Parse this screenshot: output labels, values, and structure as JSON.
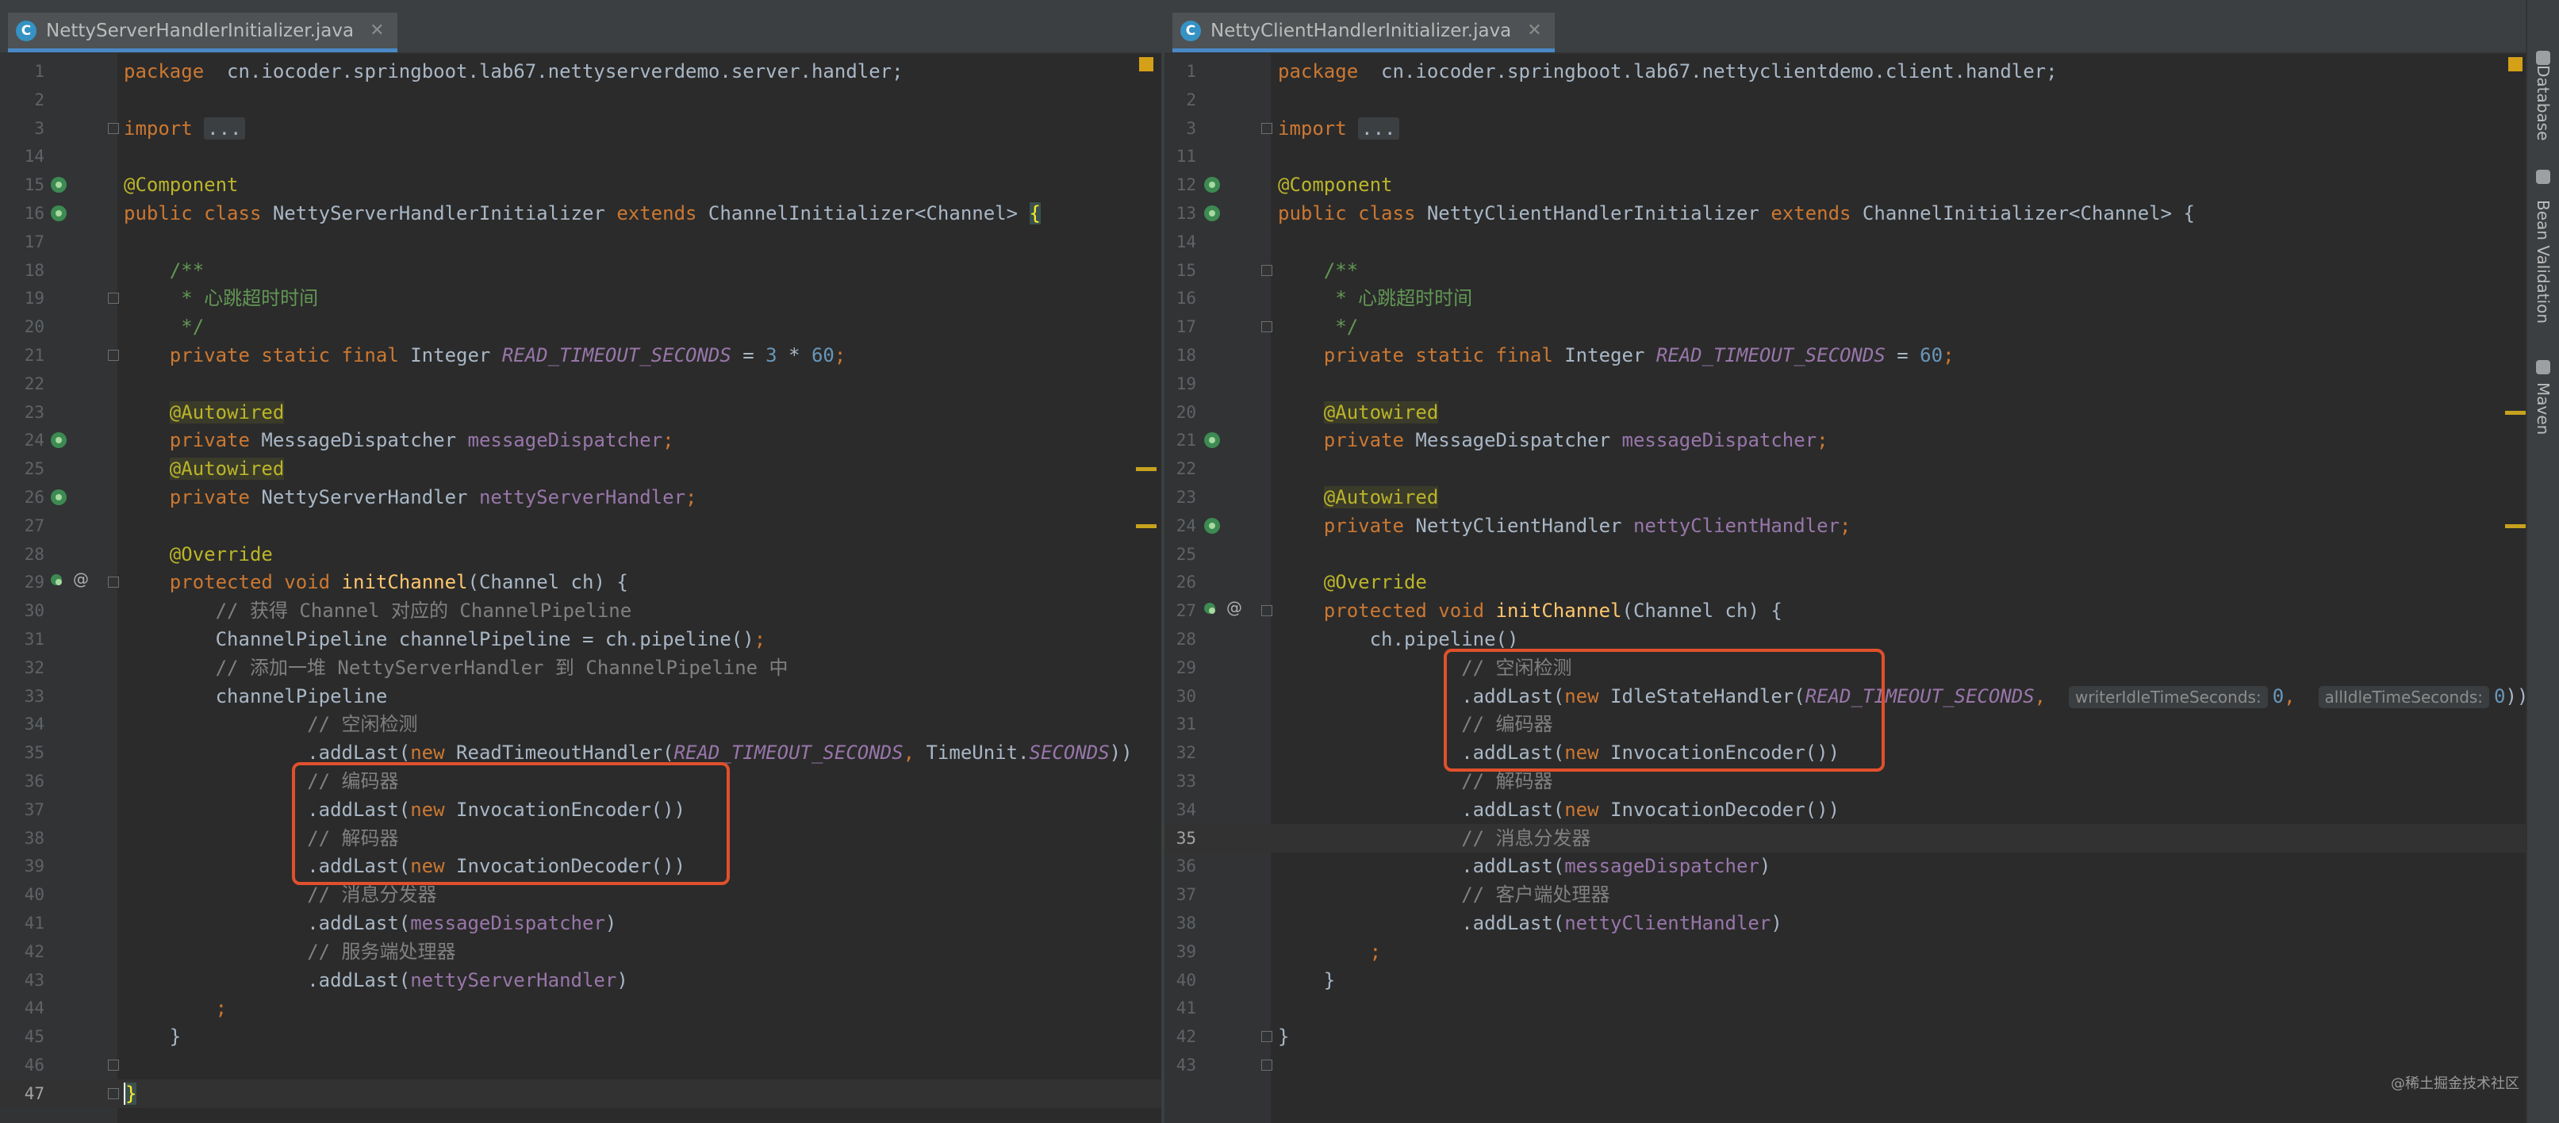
{
  "left_editor": {
    "tab_label": "NettyServerHandlerInitializer.java",
    "tab_icon": "C",
    "lines": [
      {
        "n": "1",
        "parts": [
          [
            "kw",
            "package"
          ],
          [
            "",
            "  cn.iocoder.springboot.lab67.nettyserverdemo.server.handler;"
          ]
        ]
      },
      {
        "n": "2",
        "parts": []
      },
      {
        "n": "3",
        "parts": [
          [
            "kw",
            "import"
          ],
          [
            "",
            " "
          ],
          [
            "fold-ph",
            "..."
          ]
        ]
      },
      {
        "n": "14",
        "parts": []
      },
      {
        "n": "15",
        "parts": [
          [
            "an",
            "@Component"
          ]
        ]
      },
      {
        "n": "16",
        "parts": [
          [
            "kw",
            "public class"
          ],
          [
            "",
            " NettyServerHandlerInitializer "
          ],
          [
            "kw",
            "extends"
          ],
          [
            "",
            " ChannelInitializer<Channel> "
          ],
          [
            "brace-match",
            "{"
          ]
        ]
      },
      {
        "n": "17",
        "parts": []
      },
      {
        "n": "18",
        "parts": [
          [
            "doc",
            "    /**"
          ]
        ]
      },
      {
        "n": "19",
        "parts": [
          [
            "doc",
            "     * 心跳超时时间"
          ]
        ]
      },
      {
        "n": "20",
        "parts": [
          [
            "doc",
            "     */"
          ]
        ]
      },
      {
        "n": "21",
        "parts": [
          [
            "kw",
            "    private static final"
          ],
          [
            "",
            " Integer "
          ],
          [
            "sfld",
            "READ_TIMEOUT_SECONDS"
          ],
          [
            "",
            " = "
          ],
          [
            "num",
            "3"
          ],
          [
            "",
            " * "
          ],
          [
            "num",
            "60"
          ],
          [
            "kw",
            ";"
          ]
        ]
      },
      {
        "n": "22",
        "parts": []
      },
      {
        "n": "23",
        "parts": [
          [
            "",
            "    "
          ],
          [
            "an-hl",
            "@Autowired"
          ]
        ]
      },
      {
        "n": "24",
        "parts": [
          [
            "kw",
            "    private"
          ],
          [
            "",
            " MessageDispatcher "
          ],
          [
            "fld",
            "messageDispatcher"
          ],
          [
            "kw",
            ";"
          ]
        ]
      },
      {
        "n": "25",
        "parts": [
          [
            "",
            "    "
          ],
          [
            "an-hl",
            "@Autowired"
          ]
        ]
      },
      {
        "n": "26",
        "parts": [
          [
            "kw",
            "    private"
          ],
          [
            "",
            " NettyServerHandler "
          ],
          [
            "fld",
            "nettyServerHandler"
          ],
          [
            "kw",
            ";"
          ]
        ]
      },
      {
        "n": "27",
        "parts": []
      },
      {
        "n": "28",
        "parts": [
          [
            "an",
            "    @Override"
          ]
        ]
      },
      {
        "n": "29",
        "parts": [
          [
            "kw",
            "    protected void"
          ],
          [
            "",
            " "
          ],
          [
            "fn",
            "initChannel"
          ],
          [
            "",
            "(Channel ch) {"
          ]
        ]
      },
      {
        "n": "30",
        "parts": [
          [
            "cm",
            "        // 获得 Channel 对应的 ChannelPipeline"
          ]
        ]
      },
      {
        "n": "31",
        "parts": [
          [
            "",
            "        ChannelPipeline channelPipeline = ch.pipeline()"
          ],
          [
            "kw",
            ";"
          ]
        ]
      },
      {
        "n": "32",
        "parts": [
          [
            "cm",
            "        // 添加一堆 NettyServerHandler 到 ChannelPipeline 中"
          ]
        ]
      },
      {
        "n": "33",
        "parts": [
          [
            "",
            "        channelPipeline"
          ]
        ]
      },
      {
        "n": "34",
        "parts": [
          [
            "cm",
            "                // 空闲检测"
          ]
        ]
      },
      {
        "n": "35",
        "parts": [
          [
            "",
            "                .addLast("
          ],
          [
            "kw",
            "new"
          ],
          [
            "",
            " ReadTimeoutHandler("
          ],
          [
            "sfld",
            "READ_TIMEOUT_SECONDS"
          ],
          [
            "kw",
            ","
          ],
          [
            "",
            " TimeUnit."
          ],
          [
            "sfld",
            "SECONDS"
          ],
          [
            "",
            "))"
          ]
        ]
      },
      {
        "n": "36",
        "parts": [
          [
            "cm",
            "                // 编码器"
          ]
        ]
      },
      {
        "n": "37",
        "parts": [
          [
            "",
            "                .addLast("
          ],
          [
            "kw",
            "new"
          ],
          [
            "",
            " InvocationEncoder())"
          ]
        ]
      },
      {
        "n": "38",
        "parts": [
          [
            "cm",
            "                // 解码器"
          ]
        ]
      },
      {
        "n": "39",
        "parts": [
          [
            "",
            "                .addLast("
          ],
          [
            "kw",
            "new"
          ],
          [
            "",
            " InvocationDecoder())"
          ]
        ]
      },
      {
        "n": "40",
        "parts": [
          [
            "cm",
            "                // 消息分发器"
          ]
        ]
      },
      {
        "n": "41",
        "parts": [
          [
            "",
            "                .addLast("
          ],
          [
            "fld",
            "messageDispatcher"
          ],
          [
            "",
            ")"
          ]
        ]
      },
      {
        "n": "42",
        "parts": [
          [
            "cm",
            "                // 服务端处理器"
          ]
        ]
      },
      {
        "n": "43",
        "parts": [
          [
            "",
            "                .addLast("
          ],
          [
            "fld",
            "nettyServerHandler"
          ],
          [
            "",
            ")"
          ]
        ]
      },
      {
        "n": "44",
        "parts": [
          [
            "kw",
            "        ;"
          ]
        ]
      },
      {
        "n": "45",
        "parts": [
          [
            "",
            "    }"
          ]
        ]
      },
      {
        "n": "46",
        "parts": []
      },
      {
        "n": "47",
        "parts": [
          [
            "caret",
            "}"
          ]
        ],
        "current": true
      }
    ]
  },
  "right_editor": {
    "tab_label": "NettyClientHandlerInitializer.java",
    "tab_icon": "C",
    "lines": [
      {
        "n": "1",
        "parts": [
          [
            "kw",
            "package"
          ],
          [
            "",
            "  cn.iocoder.springboot.lab67.nettyclientdemo.client.handler;"
          ]
        ]
      },
      {
        "n": "2",
        "parts": []
      },
      {
        "n": "3",
        "parts": [
          [
            "kw",
            "import"
          ],
          [
            "",
            " "
          ],
          [
            "fold-ph",
            "..."
          ]
        ]
      },
      {
        "n": "11",
        "parts": []
      },
      {
        "n": "12",
        "parts": [
          [
            "an",
            "@Component"
          ]
        ]
      },
      {
        "n": "13",
        "parts": [
          [
            "kw",
            "public class"
          ],
          [
            "",
            " NettyClientHandlerInitializer "
          ],
          [
            "kw",
            "extends"
          ],
          [
            "",
            " ChannelInitializer<Channel> {"
          ]
        ]
      },
      {
        "n": "14",
        "parts": []
      },
      {
        "n": "15",
        "parts": [
          [
            "doc",
            "    /**"
          ]
        ]
      },
      {
        "n": "16",
        "parts": [
          [
            "doc",
            "     * 心跳超时时间"
          ]
        ]
      },
      {
        "n": "17",
        "parts": [
          [
            "doc",
            "     */"
          ]
        ]
      },
      {
        "n": "18",
        "parts": [
          [
            "kw",
            "    private static final"
          ],
          [
            "",
            " Integer "
          ],
          [
            "sfld",
            "READ_TIMEOUT_SECONDS"
          ],
          [
            "",
            " = "
          ],
          [
            "num",
            "60"
          ],
          [
            "kw",
            ";"
          ]
        ]
      },
      {
        "n": "19",
        "parts": []
      },
      {
        "n": "20",
        "parts": [
          [
            "",
            "    "
          ],
          [
            "an-hl",
            "@Autowired"
          ]
        ]
      },
      {
        "n": "21",
        "parts": [
          [
            "kw",
            "    private"
          ],
          [
            "",
            " MessageDispatcher "
          ],
          [
            "fld",
            "messageDispatcher"
          ],
          [
            "kw",
            ";"
          ]
        ]
      },
      {
        "n": "22",
        "parts": []
      },
      {
        "n": "23",
        "parts": [
          [
            "",
            "    "
          ],
          [
            "an-hl",
            "@Autowired"
          ]
        ]
      },
      {
        "n": "24",
        "parts": [
          [
            "kw",
            "    private"
          ],
          [
            "",
            " NettyClientHandler "
          ],
          [
            "fld",
            "nettyClientHandler"
          ],
          [
            "kw",
            ";"
          ]
        ]
      },
      {
        "n": "25",
        "parts": []
      },
      {
        "n": "26",
        "parts": [
          [
            "an",
            "    @Override"
          ]
        ]
      },
      {
        "n": "27",
        "parts": [
          [
            "kw",
            "    protected void"
          ],
          [
            "",
            " "
          ],
          [
            "fn",
            "initChannel"
          ],
          [
            "",
            "(Channel ch) {"
          ]
        ]
      },
      {
        "n": "28",
        "parts": [
          [
            "",
            "        ch.pipeline()"
          ]
        ]
      },
      {
        "n": "29",
        "parts": [
          [
            "cm",
            "                // 空闲检测"
          ]
        ]
      },
      {
        "n": "30",
        "parts": [
          [
            "",
            "                .addLast("
          ],
          [
            "kw",
            "new"
          ],
          [
            "",
            " IdleStateHandler("
          ],
          [
            "sfld",
            "READ_TIMEOUT_SECONDS"
          ],
          [
            "kw",
            ","
          ],
          [
            "",
            "  "
          ],
          [
            "hint",
            "writerIdleTimeSeconds:"
          ],
          [
            "num",
            "0"
          ],
          [
            "kw",
            ","
          ],
          [
            "",
            "  "
          ],
          [
            "hint",
            "allIdleTimeSeconds:"
          ],
          [
            "num",
            "0"
          ],
          [
            "",
            "))"
          ]
        ]
      },
      {
        "n": "31",
        "parts": [
          [
            "cm",
            "                // 编码器"
          ]
        ]
      },
      {
        "n": "32",
        "parts": [
          [
            "",
            "                .addLast("
          ],
          [
            "kw",
            "new"
          ],
          [
            "",
            " InvocationEncoder())"
          ]
        ]
      },
      {
        "n": "33",
        "parts": [
          [
            "cm",
            "                // 解码器"
          ]
        ]
      },
      {
        "n": "34",
        "parts": [
          [
            "",
            "                .addLast("
          ],
          [
            "kw",
            "new"
          ],
          [
            "",
            " InvocationDecoder())"
          ]
        ]
      },
      {
        "n": "35",
        "parts": [
          [
            "cm",
            "                // 消息分发器"
          ]
        ],
        "current": true
      },
      {
        "n": "36",
        "parts": [
          [
            "",
            "                .addLast("
          ],
          [
            "fld",
            "messageDispatcher"
          ],
          [
            "",
            ")"
          ]
        ]
      },
      {
        "n": "37",
        "parts": [
          [
            "cm",
            "                // 客户端处理器"
          ]
        ]
      },
      {
        "n": "38",
        "parts": [
          [
            "",
            "                .addLast("
          ],
          [
            "fld",
            "nettyClientHandler"
          ],
          [
            "",
            ")"
          ]
        ]
      },
      {
        "n": "39",
        "parts": [
          [
            "kw",
            "        ;"
          ]
        ]
      },
      {
        "n": "40",
        "parts": [
          [
            "",
            "    }"
          ]
        ]
      },
      {
        "n": "41",
        "parts": []
      },
      {
        "n": "42",
        "parts": [
          [
            "",
            "}"
          ]
        ]
      },
      {
        "n": "43",
        "parts": []
      }
    ]
  },
  "side_panel": {
    "tabs": [
      "Database",
      "Bean Validation",
      "Maven"
    ]
  },
  "watermark": "@稀土掘金技术社区",
  "colors": {
    "background": "#2b2b2b",
    "keyword": "#cc7832",
    "comment": "#808080",
    "annotation": "#bbb529",
    "field": "#9876aa",
    "highlight_box": "#e0502c"
  }
}
